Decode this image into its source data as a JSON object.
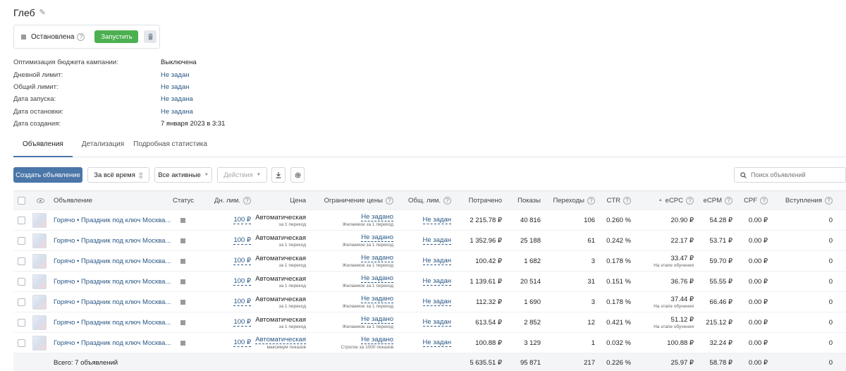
{
  "campaign": {
    "title": "Глеб",
    "status_label": "Остановлена",
    "help": "?",
    "start_button": "Запустить"
  },
  "info": [
    {
      "key": "Оптимизация бюджета кампании:",
      "value": "Выключена",
      "link": false
    },
    {
      "key": "Дневной лимит:",
      "value": "Не задан",
      "link": true
    },
    {
      "key": "Общий лимит:",
      "value": "Не задан",
      "link": true
    },
    {
      "key": "Дата запуска:",
      "value": "Не задана",
      "link": true
    },
    {
      "key": "Дата остановки:",
      "value": "Не задана",
      "link": true
    },
    {
      "key": "Дата создания:",
      "value": "7 января 2023 в 3:31",
      "link": false
    }
  ],
  "tabs": [
    "Объявления",
    "Детализация",
    "Подробная статистика"
  ],
  "toolbar": {
    "create": "Создать объявление",
    "period": "За всё время",
    "filter": "Все активные",
    "actions": "Действия",
    "search_placeholder": "Поиск объявлений"
  },
  "columns": {
    "ad": "Объявление",
    "status": "Статус",
    "daylim": "Дн. лим.",
    "price": "Цена",
    "pricelim": "Ограничение цены",
    "totlim": "Общ. лим.",
    "spent": "Потрачено",
    "shows": "Показы",
    "clicks": "Переходы",
    "ctr": "CTR",
    "ecpc": "eCPC",
    "ecpm": "eCPM",
    "cpf": "CPF",
    "joins": "Вступления"
  },
  "rows": [
    {
      "name": "Горячо • Праздник под ключ Москва...",
      "daylim": "100 ₽",
      "price": "Автоматическая",
      "price_sub": "за 1 переход",
      "plim": "Не задано",
      "plim_sub": "Желаемое за 1 переход",
      "totlim": "Не задан",
      "spent": "2 215.78 ₽",
      "shows": "40 816",
      "clicks": "106",
      "ctr": "0.260 %",
      "ecpc": "20.90 ₽",
      "ecpc_sub": "",
      "ecpm": "54.28 ₽",
      "cpf": "0.00 ₽",
      "joins": "0"
    },
    {
      "name": "Горячо • Праздник под ключ Москва...",
      "daylim": "100 ₽",
      "price": "Автоматическая",
      "price_sub": "за 1 переход",
      "plim": "Не задано",
      "plim_sub": "Желаемое за 1 переход",
      "totlim": "Не задан",
      "spent": "1 352.96 ₽",
      "shows": "25 188",
      "clicks": "61",
      "ctr": "0.242 %",
      "ecpc": "22.17 ₽",
      "ecpc_sub": "",
      "ecpm": "53.71 ₽",
      "cpf": "0.00 ₽",
      "joins": "0"
    },
    {
      "name": "Горячо • Праздник под ключ Москва...",
      "daylim": "100 ₽",
      "price": "Автоматическая",
      "price_sub": "за 1 переход",
      "plim": "Не задано",
      "plim_sub": "Желаемое за 1 переход",
      "totlim": "Не задан",
      "spent": "100.42 ₽",
      "shows": "1 682",
      "clicks": "3",
      "ctr": "0.178 %",
      "ecpc": "33.47 ₽",
      "ecpc_sub": "На этапе обучения",
      "ecpm": "59.70 ₽",
      "cpf": "0.00 ₽",
      "joins": "0"
    },
    {
      "name": "Горячо • Праздник под ключ Москва...",
      "daylim": "100 ₽",
      "price": "Автоматическая",
      "price_sub": "за 1 переход",
      "plim": "Не задано",
      "plim_sub": "Желаемое за 1 переход",
      "totlim": "Не задан",
      "spent": "1 139.61 ₽",
      "shows": "20 514",
      "clicks": "31",
      "ctr": "0.151 %",
      "ecpc": "36.76 ₽",
      "ecpc_sub": "",
      "ecpm": "55.55 ₽",
      "cpf": "0.00 ₽",
      "joins": "0"
    },
    {
      "name": "Горячо • Праздник под ключ Москва...",
      "daylim": "100 ₽",
      "price": "Автоматическая",
      "price_sub": "за 1 переход",
      "plim": "Не задано",
      "plim_sub": "Желаемое за 1 переход",
      "totlim": "Не задан",
      "spent": "112.32 ₽",
      "shows": "1 690",
      "clicks": "3",
      "ctr": "0.178 %",
      "ecpc": "37.44 ₽",
      "ecpc_sub": "На этапе обучения",
      "ecpm": "66.46 ₽",
      "cpf": "0.00 ₽",
      "joins": "0"
    },
    {
      "name": "Горячо • Праздник под ключ Москва...",
      "daylim": "100 ₽",
      "price": "Автоматическая",
      "price_sub": "за 1 переход",
      "plim": "Не задано",
      "plim_sub": "Желаемое за 1 переход",
      "totlim": "Не задан",
      "spent": "613.54 ₽",
      "shows": "2 852",
      "clicks": "12",
      "ctr": "0.421 %",
      "ecpc": "51.12 ₽",
      "ecpc_sub": "На этапе обучения",
      "ecpm": "215.12 ₽",
      "cpf": "0.00 ₽",
      "joins": "0"
    },
    {
      "name": "Горячо • Праздник под ключ Москва...",
      "daylim": "100 ₽",
      "price": "Автоматическая",
      "price_sub": "максимум показов",
      "plim": "Не задано",
      "plim_sub": "Строгое за 1000 показов",
      "totlim": "Не задан",
      "spent": "100.88 ₽",
      "shows": "3 129",
      "clicks": "1",
      "ctr": "0.032 %",
      "ecpc": "100.88 ₽",
      "ecpc_sub": "",
      "ecpm": "32.24 ₽",
      "cpf": "0.00 ₽",
      "joins": "0"
    }
  ],
  "total": {
    "label": "Всего: 7 объявлений",
    "spent": "5 635.51 ₽",
    "shows": "95 871",
    "clicks": "217",
    "ctr": "0.226 %",
    "ecpc": "25.97 ₽",
    "ecpm": "58.78 ₽",
    "cpf": "0.00 ₽",
    "joins": "0"
  }
}
